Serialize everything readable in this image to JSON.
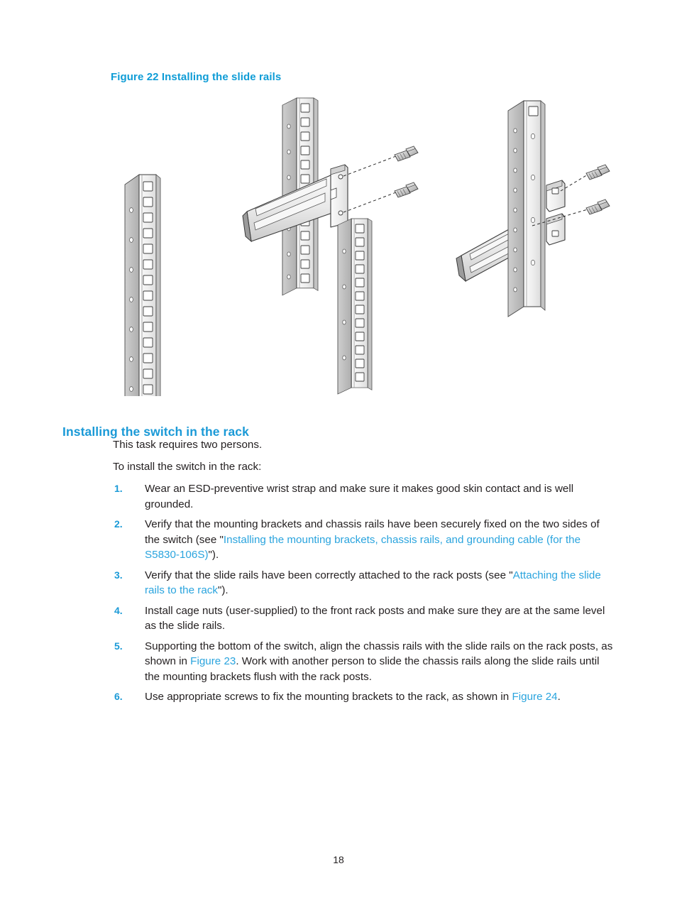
{
  "document": {
    "figure": {
      "caption": "Figure 22 Installing the slide rails",
      "accent_color": "#0e9cd6",
      "illustration_name": "rack-post-slide-rail-assembly-diagram",
      "parts": {
        "left_rack_post": "front rack post with square cage-nut holes",
        "middle_assembly": "slide rail attached to front rack post with two screws",
        "second_post": "second front rack post",
        "right_assembly": "slide rail attached to rear rack post with two bracket screws",
        "screw_count": 4,
        "fastener_name": "screw"
      }
    },
    "section": {
      "heading": "Installing the switch in the rack",
      "heading_color": "#1b9ad7",
      "intro_1": "This task requires two persons.",
      "intro_2": "To install the switch in the rack:",
      "steps": [
        {
          "num": "1.",
          "parts": [
            {
              "type": "text",
              "text": "Wear an ESD-preventive wrist strap and make sure it makes good skin contact and is well grounded."
            }
          ]
        },
        {
          "num": "2.",
          "parts": [
            {
              "type": "text",
              "text": "Verify that the mounting brackets and chassis rails have been securely fixed on the two sides of the switch (see \""
            },
            {
              "type": "link",
              "text": "Installing the mounting brackets, chassis rails, and grounding cable (for the S5830-106S)"
            },
            {
              "type": "text",
              "text": "\")."
            }
          ]
        },
        {
          "num": "3.",
          "parts": [
            {
              "type": "text",
              "text": "Verify that the slide rails have been correctly attached to the rack posts (see \""
            },
            {
              "type": "link",
              "text": "Attaching the slide rails to the rack"
            },
            {
              "type": "text",
              "text": "\")."
            }
          ]
        },
        {
          "num": "4.",
          "parts": [
            {
              "type": "text",
              "text": "Install cage nuts (user-supplied) to the front rack posts and make sure they are at the same level as the slide rails."
            }
          ]
        },
        {
          "num": "5.",
          "parts": [
            {
              "type": "text",
              "text": "Supporting the bottom of the switch, align the chassis rails with the slide rails on the rack posts, as shown in "
            },
            {
              "type": "link",
              "text": "Figure 23"
            },
            {
              "type": "text",
              "text": ". Work with another person to slide the chassis rails along the slide rails until the mounting brackets flush with the rack posts."
            }
          ]
        },
        {
          "num": "6.",
          "parts": [
            {
              "type": "text",
              "text": "Use appropriate screws to fix the mounting brackets to the rack, as shown in "
            },
            {
              "type": "link",
              "text": "Figure 24"
            },
            {
              "type": "text",
              "text": "."
            }
          ]
        }
      ]
    },
    "footer": {
      "page_number": "18"
    },
    "colors": {
      "link": "#2aa4de",
      "heading": "#1b9ad7",
      "caption": "#0e9cd6",
      "body": "#231f20",
      "metal_light": "#f2f2f2",
      "metal_mid": "#d8d8d8",
      "metal_dark": "#b5b5b5",
      "outline": "#3a3a3a"
    }
  }
}
